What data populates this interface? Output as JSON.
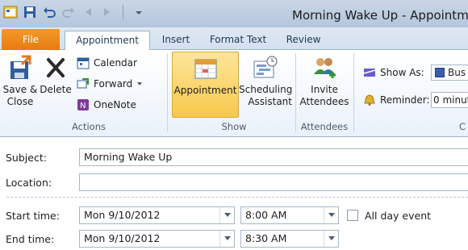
{
  "window": {
    "title": "Morning Wake Up  - Appointm"
  },
  "tabs": [
    {
      "label": "File"
    },
    {
      "label": "Appointment"
    },
    {
      "label": "Insert"
    },
    {
      "label": "Format Text"
    },
    {
      "label": "Review"
    }
  ],
  "ribbon": {
    "actions": {
      "save_close": "Save &\nClose",
      "delete": "Delete",
      "calendar": "Calendar",
      "forward": "Forward",
      "onenote": "OneNote",
      "group_label": "Actions"
    },
    "show": {
      "appointment": "Appointment",
      "scheduling": "Scheduling\nAssistant",
      "group_label": "Show"
    },
    "attendees": {
      "invite": "Invite\nAttendees",
      "group_label": "Attendees"
    },
    "options": {
      "show_as_label": "Show As:",
      "show_as_value": "Bus",
      "reminder_label": "Reminder:",
      "reminder_value": "0 minut",
      "group_label_partial": "C"
    }
  },
  "form": {
    "subject_label": "Subject:",
    "subject_value": "Morning Wake Up",
    "location_label": "Location:",
    "location_value": "",
    "start_label": "Start time:",
    "start_date": "Mon 9/10/2012",
    "start_time": "8:00 AM",
    "all_day_label": "All day event",
    "end_label": "End time:",
    "end_date": "Mon 9/10/2012",
    "end_time": "8:30 AM"
  },
  "colors": {
    "file_tab": "#e87a10",
    "active_button": "#f7c94b",
    "accent_blue": "#1e395b"
  }
}
